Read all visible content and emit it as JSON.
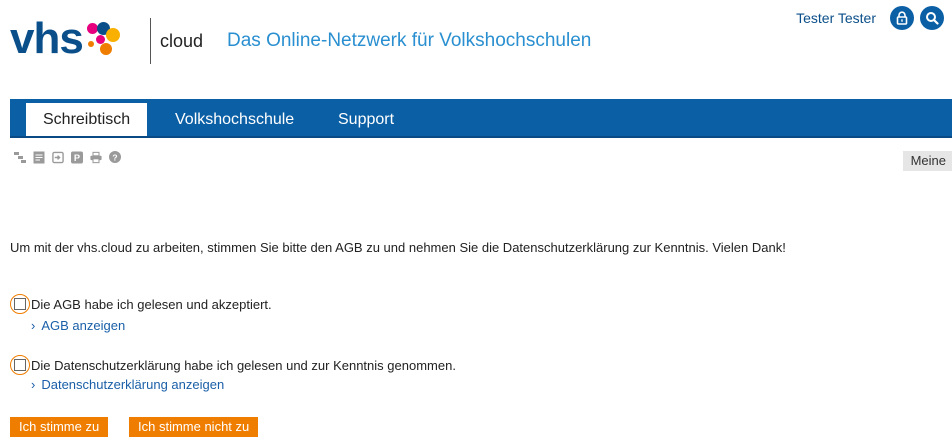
{
  "header": {
    "logo_text": "vhs",
    "logo_suffix": "cloud",
    "tagline": "Das Online-Netzwerk für Volkshochschulen",
    "user_name": "Tester Tester",
    "icons": [
      "lock-icon",
      "search-icon"
    ]
  },
  "nav": {
    "tabs": [
      {
        "label": "Schreibtisch",
        "active": true
      },
      {
        "label": "Volkshochschule",
        "active": false
      },
      {
        "label": "Support",
        "active": false
      }
    ]
  },
  "toolbar": {
    "icons": [
      "tree-icon",
      "notes-icon",
      "login-icon",
      "parking-icon",
      "print-icon",
      "help-icon"
    ],
    "meine_label": "Meine"
  },
  "content": {
    "intro": "Um mit der vhs.cloud zu arbeiten, stimmen Sie bitte den AGB zu und nehmen Sie die Datenschutzerklärung zur Kenntnis. Vielen Dank!",
    "agb_label": "Die AGB habe ich gelesen und akzeptiert.",
    "agb_link": "AGB anzeigen",
    "privacy_label": "Die Datenschutzerklärung habe ich gelesen und zur Kenntnis genommen.",
    "privacy_link": "Datenschutzerklärung anzeigen",
    "accept_button": "Ich stimme zu",
    "decline_button": "Ich stimme nicht zu"
  },
  "colors": {
    "brand_blue": "#0b5fa5",
    "accent_orange": "#ef7d00",
    "link_blue": "#1a5fa8"
  }
}
